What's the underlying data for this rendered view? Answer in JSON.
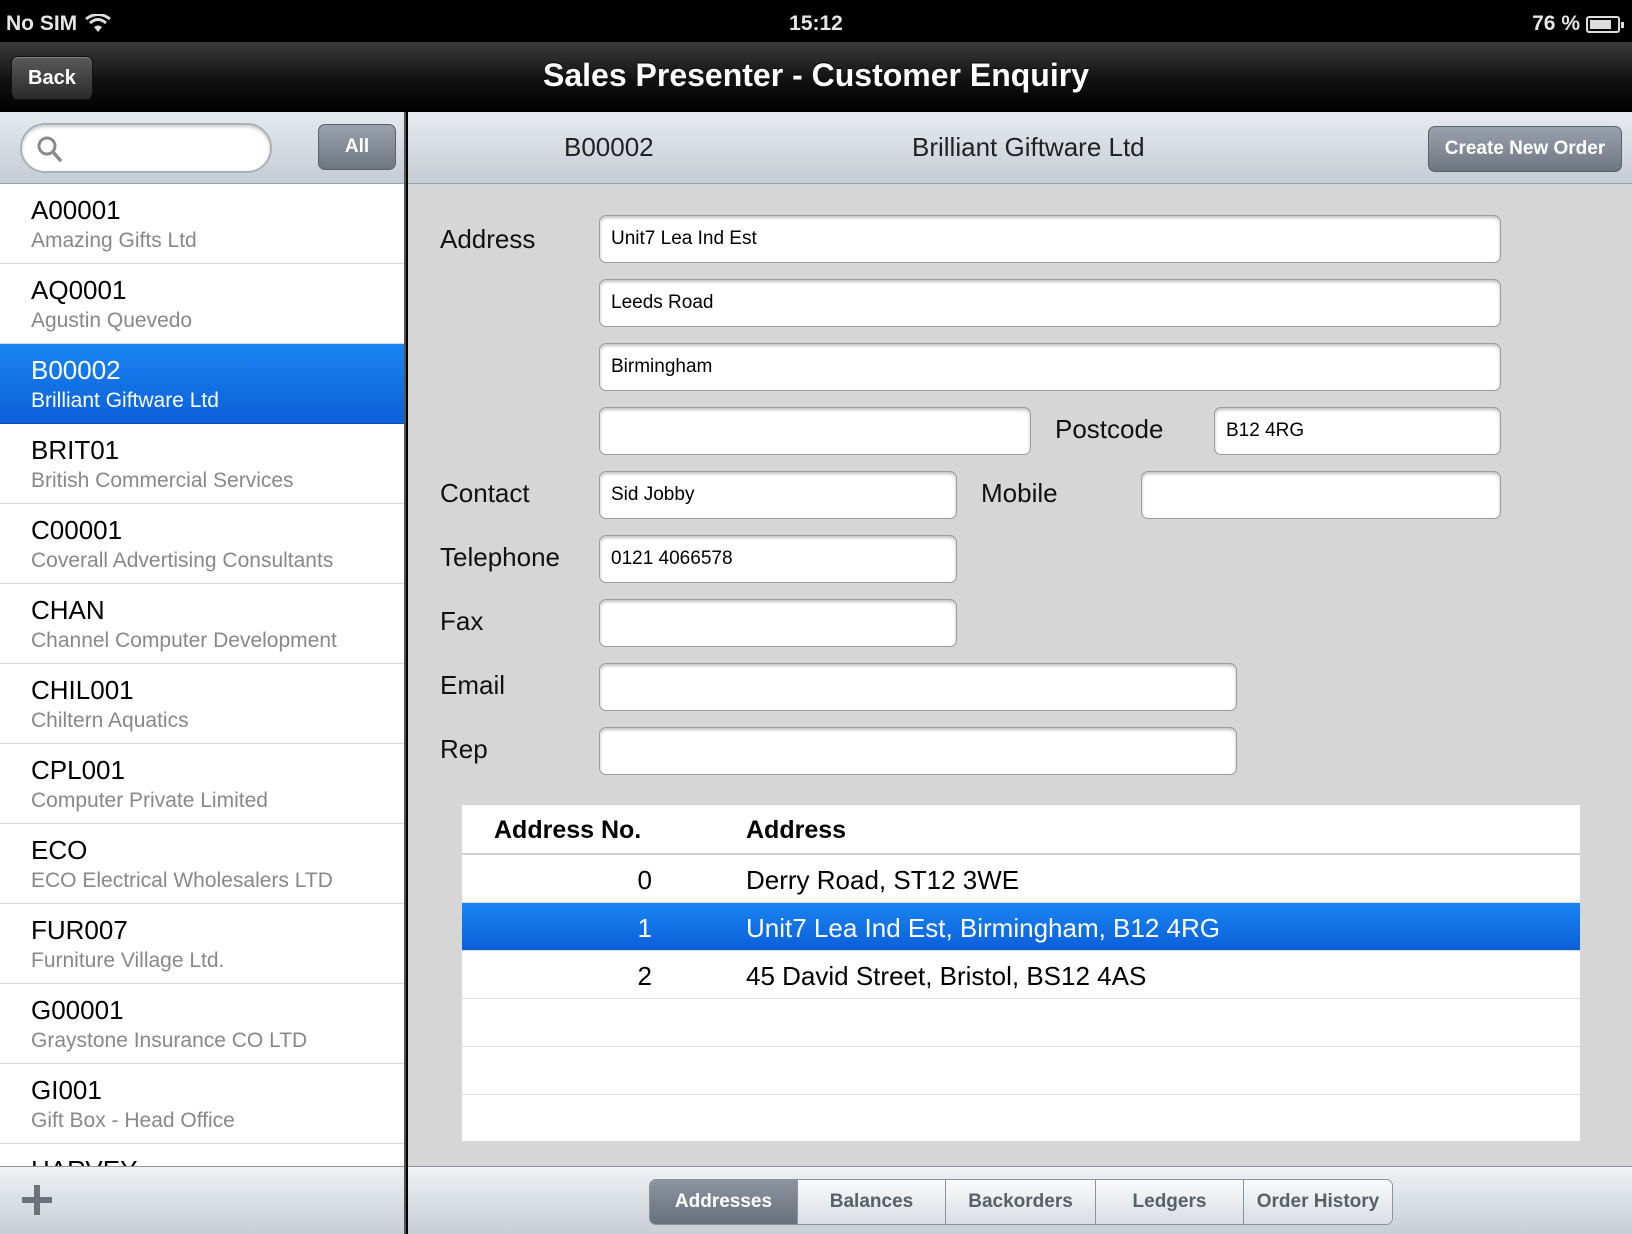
{
  "status_bar": {
    "carrier": "No SIM",
    "time": "15:12",
    "battery": "76 %"
  },
  "nav": {
    "back_label": "Back",
    "title": "Sales Presenter - Customer Enquiry"
  },
  "sidebar": {
    "search_placeholder": "",
    "filter_label": "All",
    "customers": [
      {
        "code": "A00001",
        "name": "Amazing Gifts Ltd"
      },
      {
        "code": "AQ0001",
        "name": "Agustin Quevedo"
      },
      {
        "code": "B00002",
        "name": "Brilliant Giftware Ltd"
      },
      {
        "code": "BRIT01",
        "name": "British Commercial Services"
      },
      {
        "code": "C00001",
        "name": "Coverall Advertising Consultants"
      },
      {
        "code": "CHAN",
        "name": "Channel Computer Development"
      },
      {
        "code": "CHIL001",
        "name": "Chiltern Aquatics"
      },
      {
        "code": "CPL001",
        "name": "Computer Private Limited"
      },
      {
        "code": "ECO",
        "name": "ECO Electrical Wholesalers LTD"
      },
      {
        "code": "FUR007",
        "name": "Furniture Village Ltd."
      },
      {
        "code": "G00001",
        "name": "Graystone Insurance CO LTD"
      },
      {
        "code": "GI001",
        "name": "Gift Box - Head Office"
      },
      {
        "code": "HARVEY",
        "name": ""
      }
    ]
  },
  "detail": {
    "code": "B00002",
    "name": "Brilliant Giftware Ltd",
    "create_order_label": "Create New Order",
    "labels": {
      "address": "Address",
      "postcode": "Postcode",
      "contact": "Contact",
      "mobile": "Mobile",
      "telephone": "Telephone",
      "fax": "Fax",
      "email": "Email",
      "rep": "Rep"
    },
    "values": {
      "address1": "Unit7 Lea Ind Est",
      "address2": "Leeds Road",
      "address3": "Birmingham",
      "address4": "",
      "postcode": "B12 4RG",
      "contact": "Sid Jobby",
      "mobile": "",
      "telephone": "0121 4066578",
      "fax": "",
      "email": "",
      "rep": ""
    }
  },
  "addresses_table": {
    "headers": {
      "no": "Address No.",
      "address": "Address"
    },
    "rows": [
      {
        "no": "0",
        "address": "Derry Road, ST12 3WE"
      },
      {
        "no": "1",
        "address": "Unit7 Lea Ind Est, Birmingham, B12 4RG"
      },
      {
        "no": "2",
        "address": "45 David Street, Bristol, BS12 4AS"
      }
    ]
  },
  "tabs": [
    "Addresses",
    "Balances",
    "Backorders",
    "Ledgers",
    "Order History"
  ],
  "colors": {
    "selection_blue": "#1273e8",
    "nav_black": "#000000",
    "panel_gray": "#d6d6d6"
  }
}
